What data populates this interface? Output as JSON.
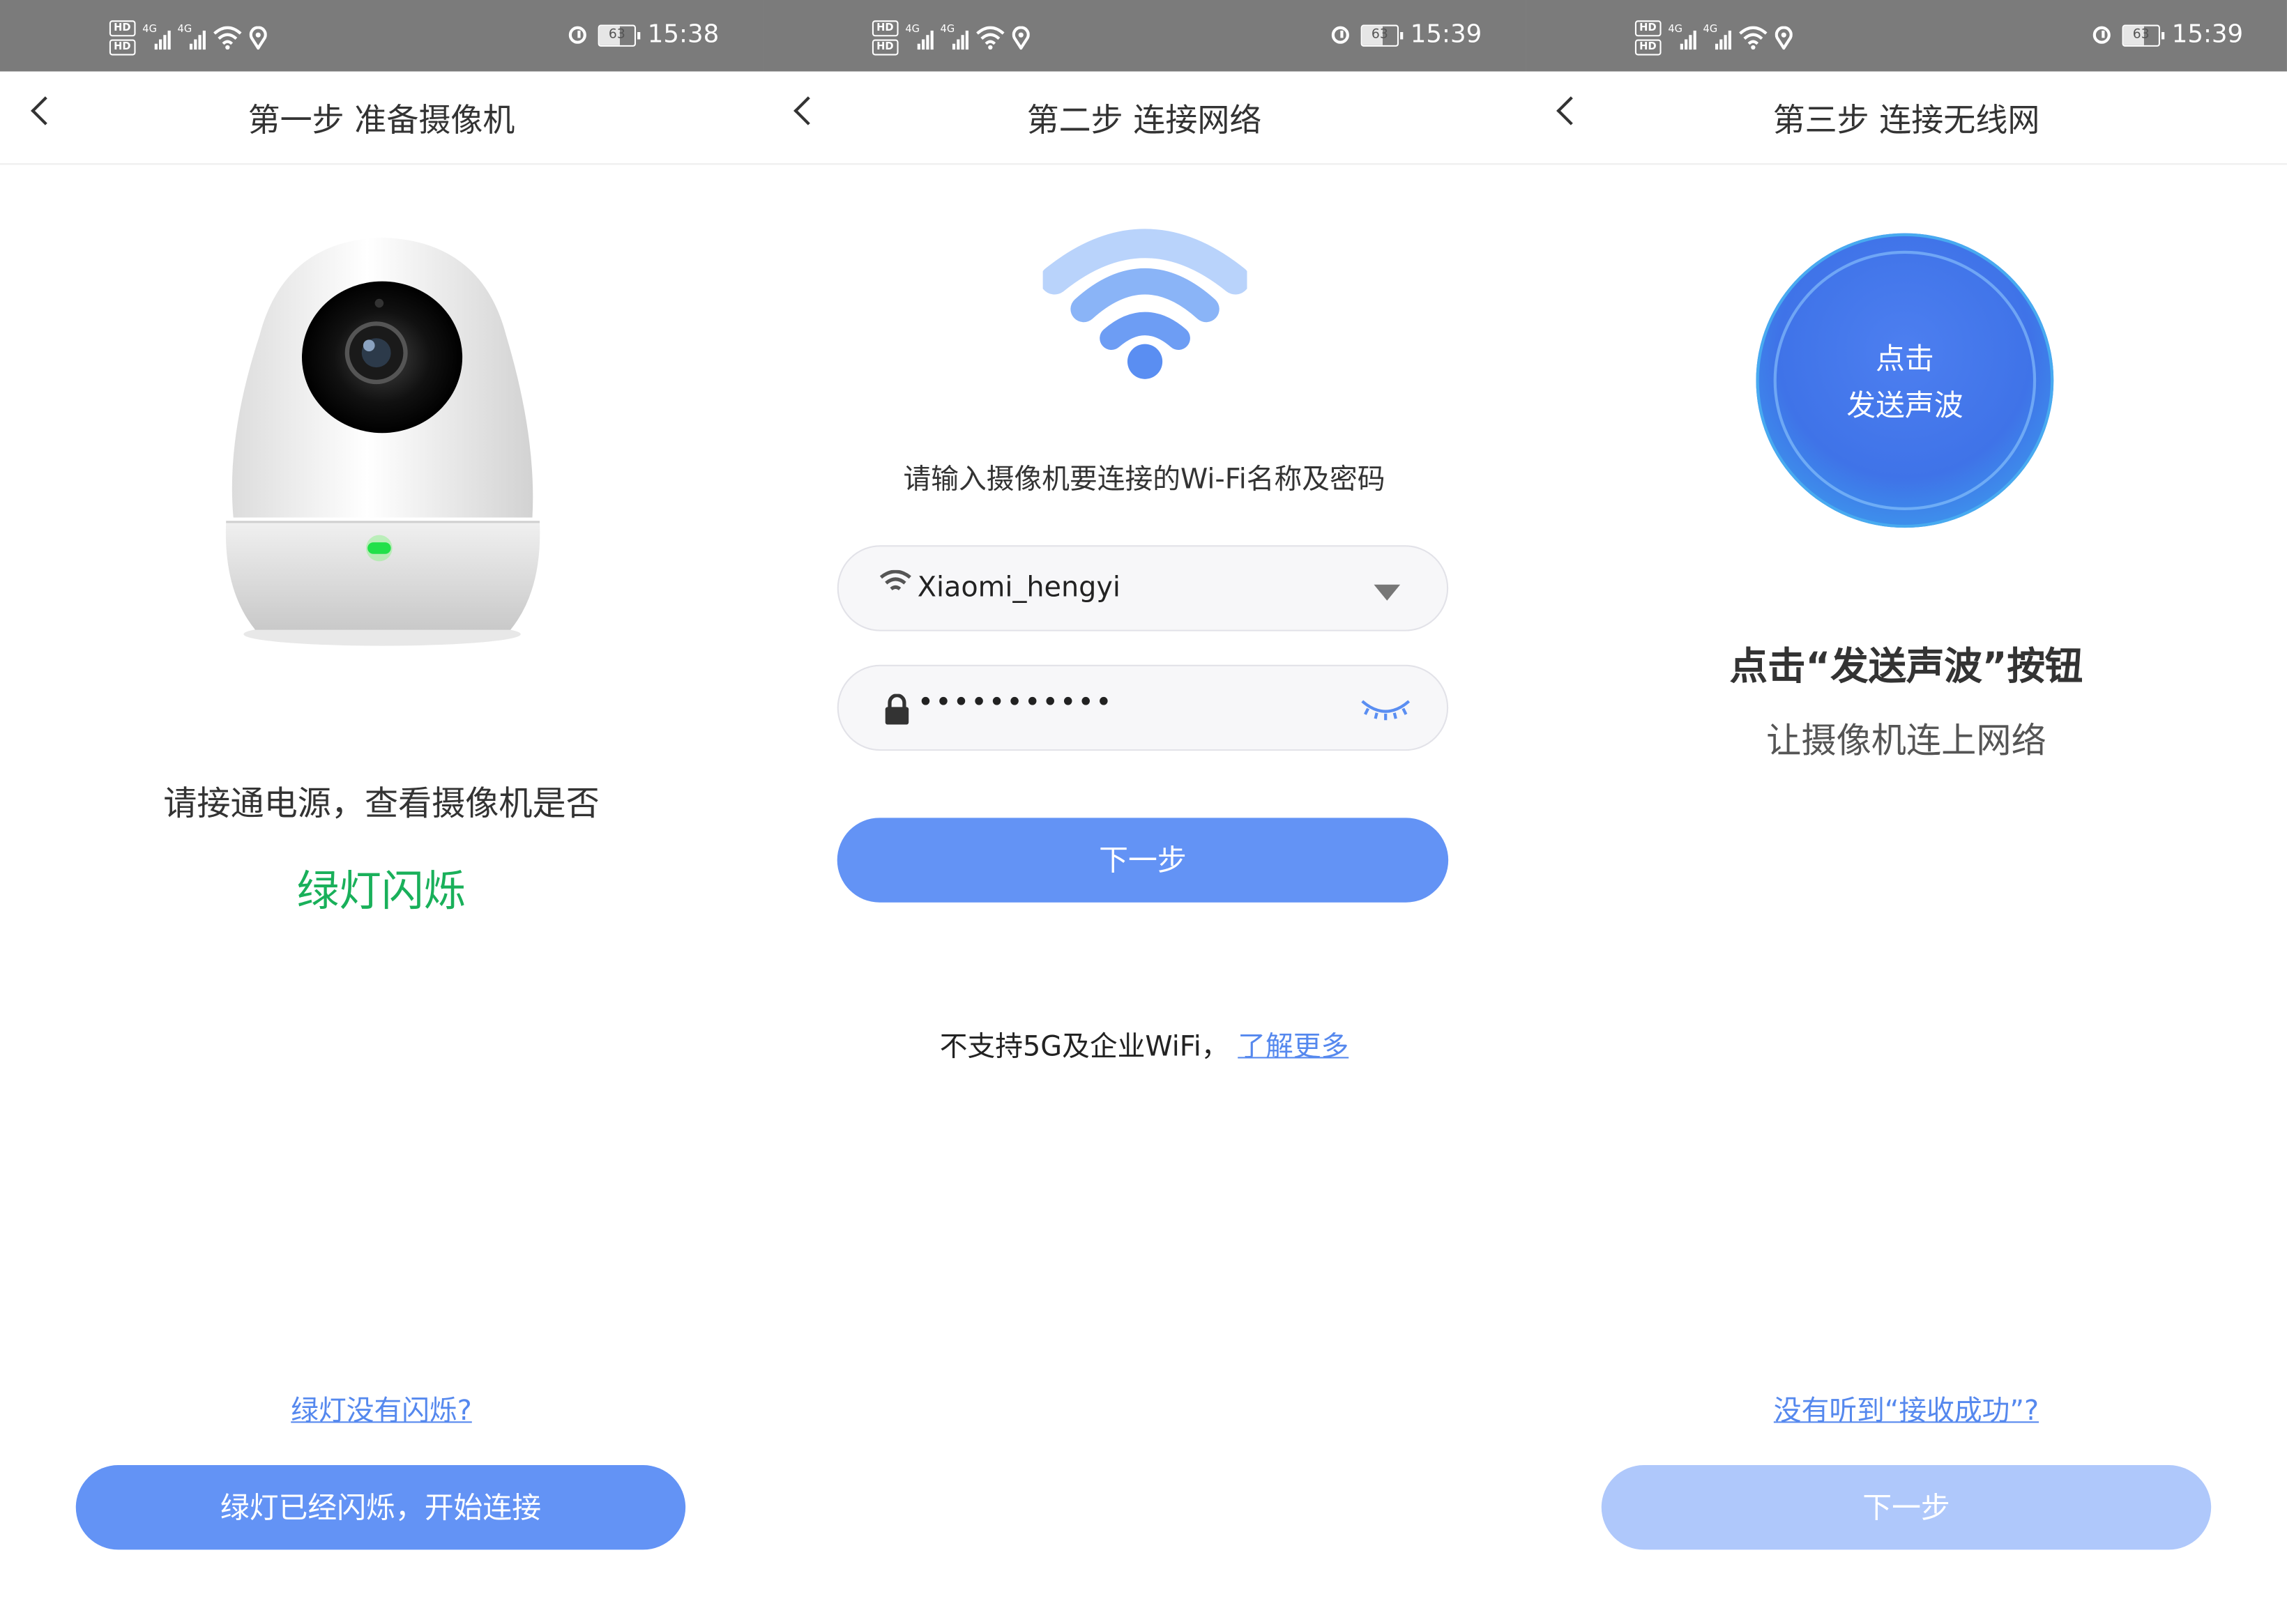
{
  "status": [
    {
      "time": "15:38",
      "battery": "63"
    },
    {
      "time": "15:39",
      "battery": "63"
    },
    {
      "time": "15:39",
      "battery": "63"
    }
  ],
  "status_icons": {
    "hd": "HD",
    "net": "4G"
  },
  "step1": {
    "title": "第一步 准备摄像机",
    "instruction": "请接通电源，查看摄像机是否",
    "highlight": "绿灯闪烁",
    "help_link": "绿灯没有闪烁?",
    "button": "绿灯已经闪烁，开始连接"
  },
  "step2": {
    "title": "第二步 连接网络",
    "prompt": "请输入摄像机要连接的Wi-Fi名称及密码",
    "ssid": "Xiaomi_hengyi",
    "password_mask": "•••••••••••",
    "button": "下一步",
    "note": "不支持5G及企业WiFi，",
    "note_link": "了解更多"
  },
  "step3": {
    "title": "第三步 连接无线网",
    "sound_line1": "点击",
    "sound_line2": "发送声波",
    "headline": "点击“发送声波”按钮",
    "subline": "让摄像机连上网络",
    "help_link": "没有听到“接收成功”?",
    "button": "下一步"
  },
  "colors": {
    "primary": "#6393f5",
    "primary_disabled": "#afc8fb",
    "green": "#19b05a",
    "link": "#5588ee",
    "statusbar": "#7b7b7b"
  }
}
